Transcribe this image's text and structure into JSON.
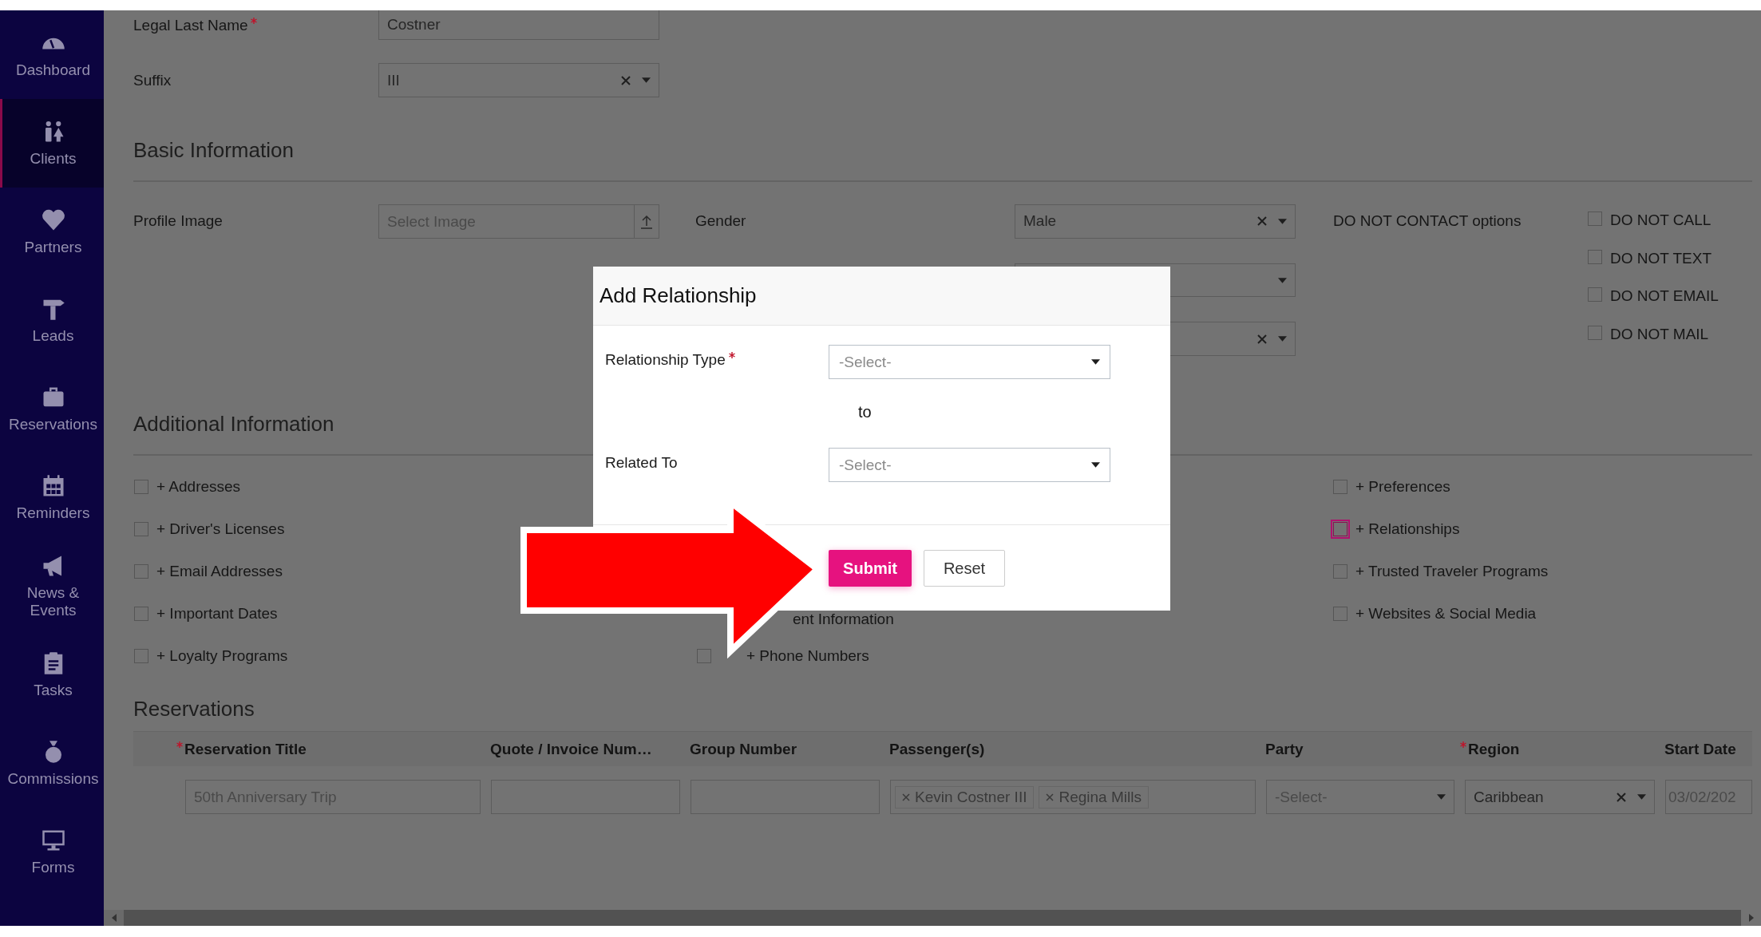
{
  "sidebar": {
    "items": [
      {
        "label": "Dashboard",
        "selected": false
      },
      {
        "label": "Clients",
        "selected": true
      },
      {
        "label": "Partners",
        "selected": false
      },
      {
        "label": "Leads",
        "selected": false
      },
      {
        "label": "Reservations",
        "selected": false
      },
      {
        "label": "Reminders",
        "selected": false
      },
      {
        "label": "News & Events",
        "selected": false
      },
      {
        "label": "Tasks",
        "selected": false
      },
      {
        "label": "Commissions",
        "selected": false
      },
      {
        "label": "Forms",
        "selected": false
      }
    ]
  },
  "name_fields": [
    {
      "label": "Legal Last Name",
      "required": true,
      "kind": "text",
      "value": "Costner"
    },
    {
      "label": "Suffix",
      "required": false,
      "kind": "select",
      "value": "III",
      "clearable": true
    }
  ],
  "basic_information": {
    "heading": "Basic Information",
    "profile_image": {
      "label": "Profile Image",
      "placeholder": "Select Image"
    },
    "gender": {
      "label": "Gender",
      "selects": [
        {
          "value": "Male",
          "clearable": true
        },
        {
          "clearable": false
        },
        {
          "clearable": true
        }
      ]
    },
    "do_not_contact": {
      "label": "DO NOT CONTACT options",
      "options": [
        {
          "label": "DO NOT CALL",
          "checked": false
        },
        {
          "label": "DO NOT TEXT",
          "checked": false
        },
        {
          "label": "DO NOT EMAIL",
          "checked": false
        },
        {
          "label": "DO NOT MAIL",
          "checked": false
        }
      ]
    }
  },
  "additional_information": {
    "heading": "Additional Information",
    "columns": [
      [
        {
          "label": "+ Addresses",
          "checked": false,
          "focused": false,
          "kind": "full"
        },
        {
          "label": "+ Driver's Licenses",
          "checked": false,
          "focused": false,
          "kind": "full"
        },
        {
          "label": "+ Email Addresses",
          "checked": false,
          "focused": false,
          "kind": "full"
        },
        {
          "label": "+ Important Dates",
          "checked": false,
          "focused": false,
          "kind": "full"
        },
        {
          "label": "+ Loyalty Programs",
          "checked": false,
          "focused": false,
          "kind": "full"
        }
      ],
      [
        {
          "label": "ent Information",
          "kind": "partial"
        },
        {
          "label": "+ Phone Numbers",
          "checked": false,
          "focused": false,
          "kind": "full"
        }
      ],
      [
        {
          "label": "+ Preferences",
          "checked": false,
          "focused": false,
          "kind": "full"
        },
        {
          "label": "+ Relationships",
          "checked": false,
          "focused": true,
          "kind": "full"
        },
        {
          "label": "+ Trusted Traveler Programs",
          "checked": false,
          "focused": false,
          "kind": "full"
        },
        {
          "label": "+ Websites & Social Media",
          "checked": false,
          "focused": false,
          "kind": "full"
        }
      ]
    ]
  },
  "reservations": {
    "heading": "Reservations",
    "columns": [
      {
        "label": "Reservation Title",
        "required": true
      },
      {
        "label": "Quote / Invoice Num…",
        "required": false
      },
      {
        "label": "Group Number",
        "required": false
      },
      {
        "label": "Passenger(s)",
        "required": false
      },
      {
        "label": "Party",
        "required": false
      },
      {
        "label": "Region",
        "required": true
      },
      {
        "label": "Start Date",
        "required": false
      }
    ],
    "row": [
      {
        "kind": "text",
        "placeholder": "50th Anniversary Trip"
      },
      {
        "kind": "text"
      },
      {
        "kind": "text"
      },
      {
        "kind": "tags",
        "tags": [
          "Kevin Costner III",
          "Regina Mills"
        ]
      },
      {
        "kind": "select",
        "placeholder": "-Select-",
        "clearable": false
      },
      {
        "kind": "select",
        "value": "Caribbean",
        "clearable": true
      },
      {
        "kind": "text",
        "value": "03/02/202"
      }
    ]
  },
  "modal": {
    "title": "Add Relationship",
    "fields": [
      {
        "label": "Relationship Type",
        "required": true,
        "placeholder": "-Select-"
      },
      {
        "label": "Related To",
        "required": false,
        "placeholder": "-Select-"
      }
    ],
    "connector": "to",
    "buttons": [
      {
        "label": "Submit",
        "kind": "primary"
      },
      {
        "label": "Reset",
        "kind": "secondary"
      }
    ]
  }
}
